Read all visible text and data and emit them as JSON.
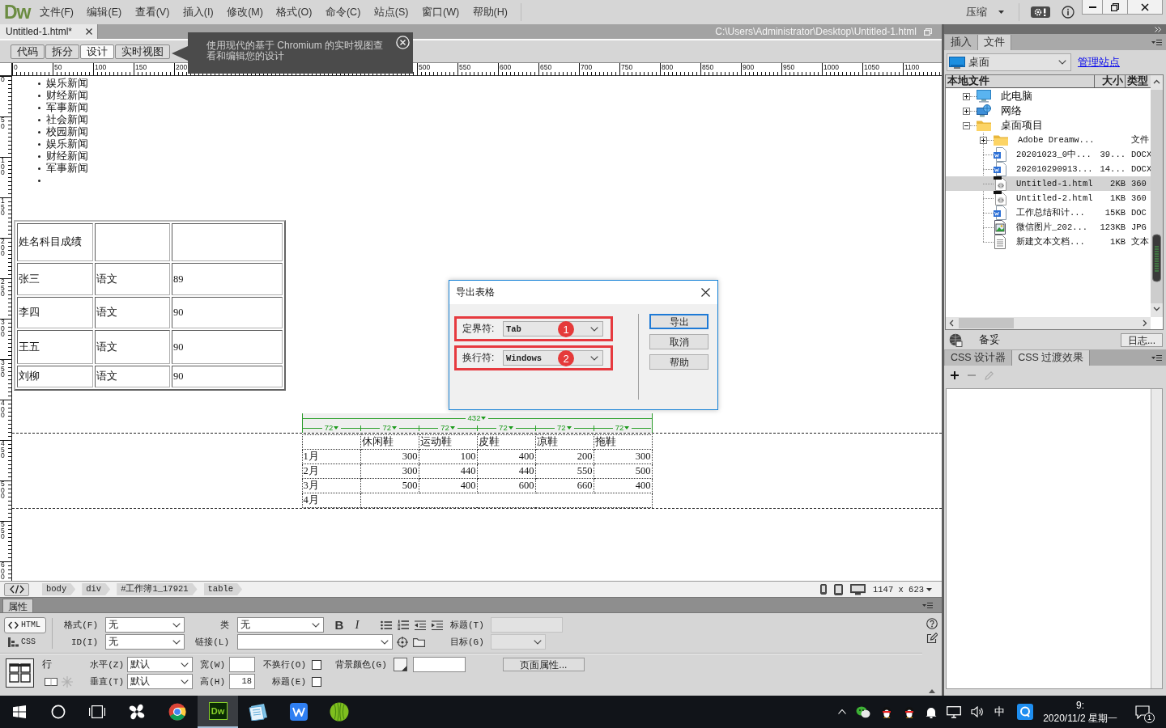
{
  "app_logo": "Dw",
  "menu": [
    "文件(F)",
    "编辑(E)",
    "查看(V)",
    "插入(I)",
    "修改(M)",
    "格式(O)",
    "命令(C)",
    "站点(S)",
    "窗口(W)",
    "帮助(H)"
  ],
  "workspace_switcher": {
    "label": "压缩"
  },
  "document_tab": {
    "title": "Untitled-1.html*",
    "path": "C:\\Users\\Administrator\\Desktop\\Untitled-1.html"
  },
  "view_buttons": [
    {
      "label": "代码",
      "selected": false
    },
    {
      "label": "拆分",
      "selected": false
    },
    {
      "label": "设计",
      "selected": true
    },
    {
      "label": "实时视图",
      "selected": false
    }
  ],
  "tooltip": {
    "text": "使用现代的基于 Chromium 的实时视图查看和编辑您的设计"
  },
  "ruler": {
    "horizontal": [
      "0",
      "50",
      "100",
      "150",
      "200",
      "500",
      "550",
      "600",
      "650",
      "700",
      "750",
      "800",
      "850",
      "900",
      "950",
      "1000",
      "1050",
      "1100"
    ],
    "vertical": [
      "0",
      "50",
      "100",
      "150",
      "200",
      "250",
      "300",
      "350",
      "400",
      "450",
      "500",
      "550",
      "600"
    ]
  },
  "news_list": {
    "items": [
      "娱乐新闻",
      "财经新闻",
      "军事新闻",
      "社会新闻",
      "校园新闻",
      "娱乐新闻",
      "财经新闻",
      "军事新闻"
    ],
    "trailing_empty_item": true
  },
  "scores_table": {
    "rows": [
      [
        "姓名科目成绩"
      ],
      [
        "张三",
        "语文",
        "89"
      ],
      [
        "李四",
        "语文",
        "90"
      ],
      [
        "王五",
        "语文",
        "90"
      ],
      [
        "刘柳",
        "语文",
        "90"
      ]
    ]
  },
  "sales_table": {
    "width_label": "432",
    "column_width_labels": [
      "72",
      "72",
      "72",
      "72",
      "72",
      "72"
    ],
    "columns": [
      "休闲鞋",
      "运动鞋",
      "皮鞋",
      "凉鞋",
      "拖鞋"
    ],
    "rows": [
      {
        "label": "1月",
        "values": [
          "300",
          "100",
          "400",
          "200",
          "300"
        ]
      },
      {
        "label": "2月",
        "values": [
          "300",
          "440",
          "440",
          "550",
          "500"
        ]
      },
      {
        "label": "3月",
        "values": [
          "500",
          "400",
          "600",
          "660",
          "400"
        ]
      },
      {
        "label": "4月"
      }
    ]
  },
  "export_dialog": {
    "title": "导出表格",
    "fields": [
      {
        "label": "定界符:",
        "value": "Tab",
        "callout": "1"
      },
      {
        "label": "换行符:",
        "value": "Windows",
        "callout": "2"
      }
    ],
    "buttons": [
      {
        "label": "导出",
        "focused": true
      },
      {
        "label": "取消",
        "focused": false
      },
      {
        "label": "帮助",
        "focused": false
      }
    ]
  },
  "tag_selector": {
    "tags": [
      "body",
      "div",
      "#工作簿1_17921",
      "table"
    ],
    "window_size": "1147 x 623"
  },
  "properties": {
    "title": "属性",
    "mode_buttons": [
      {
        "kind": "html",
        "label": "HTML",
        "selected": true
      },
      {
        "kind": "css",
        "label": "CSS",
        "selected": false
      }
    ],
    "format": {
      "label": "格式(F)",
      "value": "无"
    },
    "id": {
      "label": "ID(I)",
      "value": "无"
    },
    "class": {
      "label": "类",
      "value": "无"
    },
    "link": {
      "label": "链接(L)"
    },
    "text_buttons": [
      {
        "kind": "bold",
        "label": "B"
      },
      {
        "kind": "italic",
        "label": "I"
      }
    ],
    "title_field": {
      "label": "标题(T)",
      "disabled": true
    },
    "target": {
      "label": "目标(G)",
      "disabled": true
    },
    "row_label": "行",
    "horizontal": {
      "label": "水平(Z)",
      "value": "默认"
    },
    "vertical": {
      "label": "垂直(T)",
      "value": "默认"
    },
    "width": {
      "label": "宽(W)"
    },
    "height": {
      "label": "高(H)",
      "value": "18"
    },
    "no_wrap": {
      "label": "不换行(O)",
      "checked": false
    },
    "header": {
      "label": "标题(E)",
      "checked": false
    },
    "background_color": {
      "label": "背景颜色(G)"
    },
    "page_properties": "页面属性..."
  },
  "files_panel": {
    "tabs": [
      {
        "label": "插入",
        "selected": false
      },
      {
        "label": "文件",
        "selected": true
      }
    ],
    "site": "桌面",
    "manage_sites_link": "管理站点",
    "columns": [
      "本地文件",
      "大小",
      "类型"
    ],
    "tree": [
      {
        "name": "此电脑",
        "kind": "computer",
        "expanded": false,
        "selected": false
      },
      {
        "name": "网络",
        "kind": "network",
        "expanded": false,
        "selected": false
      },
      {
        "name": "桌面项目",
        "kind": "folder",
        "expanded": true,
        "selected": false,
        "children": [
          {
            "name": "Adobe Dreamw...",
            "kind": "folder",
            "expanded": false,
            "type": "文件",
            "selected": false
          },
          {
            "name": "20201023_0中...",
            "kind": "word",
            "size": "39...",
            "type": "DOCX",
            "selected": false
          },
          {
            "name": "202010290913...",
            "kind": "word",
            "size": "14...",
            "type": "DOCX",
            "selected": false
          },
          {
            "name": "Untitled-1.html",
            "kind": "html",
            "size": "2KB",
            "type": "360",
            "selected": true
          },
          {
            "name": "Untitled-2.html",
            "kind": "html",
            "size": "1KB",
            "type": "360",
            "selected": false
          },
          {
            "name": "工作总结和计...",
            "kind": "word",
            "size": "15KB",
            "type": "DOC",
            "selected": false
          },
          {
            "name": "微信图片_202...",
            "kind": "image",
            "size": "123KB",
            "type": "JPG",
            "selected": false
          },
          {
            "name": "新建文本文档...",
            "kind": "text",
            "size": "1KB",
            "type": "文本",
            "selected": false
          }
        ]
      }
    ],
    "status": "备妥",
    "log_button": "日志..."
  },
  "css_panel": {
    "tabs": [
      {
        "label": "CSS 设计器",
        "selected": false
      },
      {
        "label": "CSS 过渡效果",
        "selected": true
      }
    ]
  },
  "taskbar": {
    "apps": [
      {
        "kind": "pinwheel",
        "active": false
      },
      {
        "kind": "browser",
        "active": false
      },
      {
        "kind": "dreamweaver",
        "label": "Dw",
        "active": true
      },
      {
        "kind": "notes",
        "active": false
      },
      {
        "kind": "writer",
        "active": false
      },
      {
        "kind": "ball",
        "active": false
      }
    ],
    "ime": "中",
    "time": "9:",
    "date": "2020/11/2 星期一",
    "notification_count": "1"
  }
}
